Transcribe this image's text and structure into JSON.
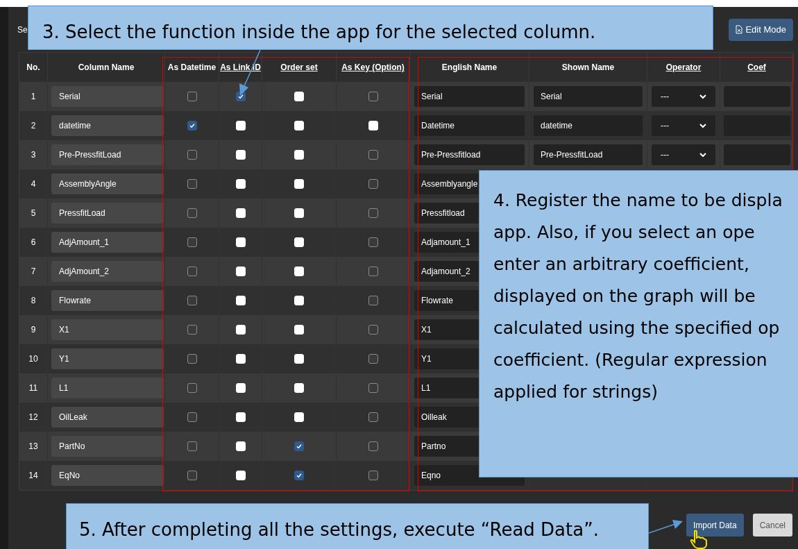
{
  "dialog": {
    "title": "Se",
    "edit_button": "Edit Mode"
  },
  "table": {
    "columns": [
      {
        "label": "No.",
        "underlined": false
      },
      {
        "label": "Column Name",
        "underlined": false
      },
      {
        "label": "As Datetime",
        "underlined": false
      },
      {
        "label": "As Link ID",
        "underlined": true
      },
      {
        "label": "Order set",
        "underlined": true
      },
      {
        "label": "As Key (Option)",
        "underlined": true
      },
      {
        "label": "English Name",
        "underlined": false
      },
      {
        "label": "Shown Name",
        "underlined": false
      },
      {
        "label": "Operator",
        "underlined": true
      },
      {
        "label": "Coef",
        "underlined": true
      }
    ],
    "rows": [
      {
        "no": "1",
        "column_name": "Serial",
        "flags": [
          {
            "checked": false,
            "disabled": true
          },
          {
            "checked": true,
            "disabled": false
          },
          {
            "checked": false,
            "disabled": false
          },
          {
            "checked": false,
            "disabled": true
          }
        ],
        "english_name": "Serial",
        "shown_name": "Serial",
        "operator": "---"
      },
      {
        "no": "2",
        "column_name": "datetime",
        "flags": [
          {
            "checked": true,
            "disabled": false
          },
          {
            "checked": false,
            "disabled": false
          },
          {
            "checked": false,
            "disabled": false
          },
          {
            "checked": false,
            "disabled": false
          }
        ],
        "english_name": "Datetime",
        "shown_name": "datetime",
        "operator": "---"
      },
      {
        "no": "3",
        "column_name": "Pre-PressfitLoad",
        "flags": [
          {
            "checked": false,
            "disabled": true
          },
          {
            "checked": false,
            "disabled": false
          },
          {
            "checked": false,
            "disabled": false
          },
          {
            "checked": false,
            "disabled": true
          }
        ],
        "english_name": "Pre-Pressfitload",
        "shown_name": "Pre-PressfitLoad",
        "operator": "---"
      },
      {
        "no": "4",
        "column_name": "AssemblyAngle",
        "flags": [
          {
            "checked": false,
            "disabled": true
          },
          {
            "checked": false,
            "disabled": false
          },
          {
            "checked": false,
            "disabled": false
          },
          {
            "checked": false,
            "disabled": true
          }
        ],
        "english_name": "Assemblyangle"
      },
      {
        "no": "5",
        "column_name": "PressfitLoad",
        "flags": [
          {
            "checked": false,
            "disabled": true
          },
          {
            "checked": false,
            "disabled": false
          },
          {
            "checked": false,
            "disabled": false
          },
          {
            "checked": false,
            "disabled": true
          }
        ],
        "english_name": "Pressfitload"
      },
      {
        "no": "6",
        "column_name": "AdjAmount_1",
        "flags": [
          {
            "checked": false,
            "disabled": true
          },
          {
            "checked": false,
            "disabled": false
          },
          {
            "checked": false,
            "disabled": false
          },
          {
            "checked": false,
            "disabled": true
          }
        ],
        "english_name": "Adjamount_1"
      },
      {
        "no": "7",
        "column_name": "AdjAmount_2",
        "flags": [
          {
            "checked": false,
            "disabled": true
          },
          {
            "checked": false,
            "disabled": false
          },
          {
            "checked": false,
            "disabled": false
          },
          {
            "checked": false,
            "disabled": true
          }
        ],
        "english_name": "Adjamount_2"
      },
      {
        "no": "8",
        "column_name": "Flowrate",
        "flags": [
          {
            "checked": false,
            "disabled": true
          },
          {
            "checked": false,
            "disabled": false
          },
          {
            "checked": false,
            "disabled": false
          },
          {
            "checked": false,
            "disabled": true
          }
        ],
        "english_name": "Flowrate"
      },
      {
        "no": "9",
        "column_name": "X1",
        "flags": [
          {
            "checked": false,
            "disabled": true
          },
          {
            "checked": false,
            "disabled": false
          },
          {
            "checked": false,
            "disabled": false
          },
          {
            "checked": false,
            "disabled": true
          }
        ],
        "english_name": "X1"
      },
      {
        "no": "10",
        "column_name": "Y1",
        "flags": [
          {
            "checked": false,
            "disabled": true
          },
          {
            "checked": false,
            "disabled": false
          },
          {
            "checked": false,
            "disabled": false
          },
          {
            "checked": false,
            "disabled": true
          }
        ],
        "english_name": "Y1"
      },
      {
        "no": "11",
        "column_name": "L1",
        "flags": [
          {
            "checked": false,
            "disabled": true
          },
          {
            "checked": false,
            "disabled": false
          },
          {
            "checked": false,
            "disabled": false
          },
          {
            "checked": false,
            "disabled": true
          }
        ],
        "english_name": "L1"
      },
      {
        "no": "12",
        "column_name": "OilLeak",
        "flags": [
          {
            "checked": false,
            "disabled": true
          },
          {
            "checked": false,
            "disabled": false
          },
          {
            "checked": false,
            "disabled": false
          },
          {
            "checked": false,
            "disabled": true
          }
        ],
        "english_name": "Oilleak"
      },
      {
        "no": "13",
        "column_name": "PartNo",
        "flags": [
          {
            "checked": false,
            "disabled": true
          },
          {
            "checked": false,
            "disabled": false
          },
          {
            "checked": true,
            "disabled": false
          },
          {
            "checked": false,
            "disabled": true
          }
        ],
        "english_name": "Partno"
      },
      {
        "no": "14",
        "column_name": "EqNo",
        "flags": [
          {
            "checked": false,
            "disabled": true
          },
          {
            "checked": false,
            "disabled": false
          },
          {
            "checked": true,
            "disabled": false
          },
          {
            "checked": false,
            "disabled": true
          }
        ],
        "english_name": "Eqno"
      }
    ]
  },
  "buttons": [
    {
      "label": "Import Data",
      "kind": "primary"
    },
    {
      "label": "Cancel",
      "kind": "secondary"
    }
  ],
  "callouts": [
    {
      "kind": "top",
      "lines": [
        "3. Select the function inside the app for the selected column."
      ]
    },
    {
      "kind": "side",
      "lines": [
        "4. Register the name to be displa",
        "app. Also, if you select an ope",
        "enter an arbitrary coefficient,",
        "displayed on the graph will be",
        "calculated using the specified op",
        "coefficient. (Regular expression",
        "applied for strings)"
      ]
    },
    {
      "kind": "bottom",
      "lines": [
        "5. After completing all the settings, execute “Read Data”."
      ]
    }
  ]
}
